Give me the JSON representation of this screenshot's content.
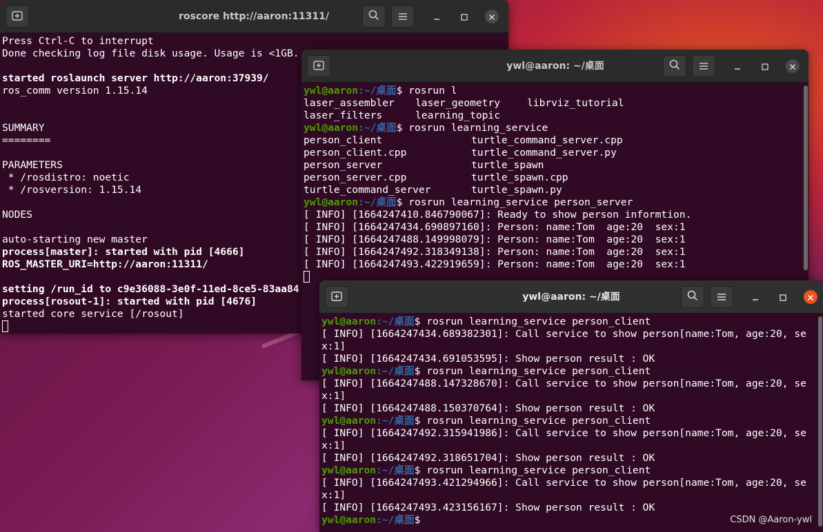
{
  "windows": {
    "roscore": {
      "title": "roscore http://aaron:11311/",
      "lines": [
        {
          "t": "Press Ctrl-C to interrupt"
        },
        {
          "t": "Done checking log file disk usage. Usage is <1GB."
        },
        {
          "t": ""
        },
        {
          "t": "started roslaunch server http://aaron:37939/",
          "bold": true
        },
        {
          "t": "ros_comm version 1.15.14"
        },
        {
          "t": ""
        },
        {
          "t": ""
        },
        {
          "t": "SUMMARY"
        },
        {
          "t": "========"
        },
        {
          "t": ""
        },
        {
          "t": "PARAMETERS"
        },
        {
          "t": " * /rosdistro: noetic"
        },
        {
          "t": " * /rosversion: 1.15.14"
        },
        {
          "t": ""
        },
        {
          "t": "NODES"
        },
        {
          "t": ""
        },
        {
          "t": "auto-starting new master"
        },
        {
          "t": "process[master]: started with pid [4666]",
          "bold": true
        },
        {
          "t": "ROS_MASTER_URI=http://aaron:11311/",
          "bold": true
        },
        {
          "t": ""
        },
        {
          "t": "setting /run_id to c9e36088-3e0f-11ed-8ce5-83aa84",
          "bold": true
        },
        {
          "t": "process[rosout-1]: started with pid [4676]",
          "bold": true
        },
        {
          "t": "started core service [/rosout]"
        }
      ]
    },
    "server": {
      "title": "ywl@aaron: ~/桌面",
      "prompt_user": "ywl@aaron",
      "prompt_path": ":~/桌面",
      "prompt_sign": "$ ",
      "lines": [
        {
          "kind": "prompt",
          "cmd": "rosrun l"
        },
        {
          "kind": "cols3",
          "cells": [
            "laser_assembler",
            "laser_geometry",
            "librviz_tutorial"
          ]
        },
        {
          "kind": "cols3",
          "cells": [
            "laser_filters",
            "learning_topic",
            ""
          ]
        },
        {
          "kind": "prompt",
          "cmd": "rosrun learning_service"
        },
        {
          "kind": "cols2",
          "cells": [
            "person_client",
            "turtle_command_server.cpp"
          ]
        },
        {
          "kind": "cols2",
          "cells": [
            "person_client.cpp",
            "turtle_command_server.py"
          ]
        },
        {
          "kind": "cols2",
          "cells": [
            "person_server",
            "turtle_spawn"
          ]
        },
        {
          "kind": "cols2",
          "cells": [
            "person_server.cpp",
            "turtle_spawn.cpp"
          ]
        },
        {
          "kind": "cols2",
          "cells": [
            "turtle_command_server",
            "turtle_spawn.py"
          ]
        },
        {
          "kind": "prompt",
          "cmd": "rosrun learning_service person_server"
        },
        {
          "kind": "text",
          "t": "[ INFO] [1664247410.846790067]: Ready to show person informtion."
        },
        {
          "kind": "text",
          "t": "[ INFO] [1664247434.690897160]: Person: name:Tom  age:20  sex:1"
        },
        {
          "kind": "text",
          "t": "[ INFO] [1664247488.149998079]: Person: name:Tom  age:20  sex:1"
        },
        {
          "kind": "text",
          "t": "[ INFO] [1664247492.318349138]: Person: name:Tom  age:20  sex:1"
        },
        {
          "kind": "text",
          "t": "[ INFO] [1664247493.422919659]: Person: name:Tom  age:20  sex:1"
        }
      ]
    },
    "client": {
      "title": "ywl@aaron: ~/桌面",
      "prompt_user": "ywl@aaron",
      "prompt_path": ":~/桌面",
      "prompt_sign": "$ ",
      "lines": [
        {
          "kind": "prompt",
          "cmd": "rosrun learning_service person_client"
        },
        {
          "kind": "text",
          "t": "[ INFO] [1664247434.689382301]: Call service to show person[name:Tom, age:20, se"
        },
        {
          "kind": "text",
          "t": "x:1]"
        },
        {
          "kind": "text",
          "t": "[ INFO] [1664247434.691053595]: Show person result : OK"
        },
        {
          "kind": "prompt",
          "cmd": "rosrun learning_service person_client"
        },
        {
          "kind": "text",
          "t": "[ INFO] [1664247488.147328670]: Call service to show person[name:Tom, age:20, se"
        },
        {
          "kind": "text",
          "t": "x:1]"
        },
        {
          "kind": "text",
          "t": "[ INFO] [1664247488.150370764]: Show person result : OK"
        },
        {
          "kind": "prompt",
          "cmd": "rosrun learning_service person_client"
        },
        {
          "kind": "text",
          "t": "[ INFO] [1664247492.315941986]: Call service to show person[name:Tom, age:20, se"
        },
        {
          "kind": "text",
          "t": "x:1]"
        },
        {
          "kind": "text",
          "t": "[ INFO] [1664247492.318651704]: Show person result : OK"
        },
        {
          "kind": "prompt",
          "cmd": "rosrun learning_service person_client"
        },
        {
          "kind": "text",
          "t": "[ INFO] [1664247493.421294966]: Call service to show person[name:Tom, age:20, se"
        },
        {
          "kind": "text",
          "t": "x:1]"
        },
        {
          "kind": "text",
          "t": "[ INFO] [1664247493.423156167]: Show person result : OK"
        },
        {
          "kind": "prompt",
          "cmd": ""
        }
      ]
    }
  },
  "watermark": "CSDN @Aaron-ywl",
  "colors": {
    "terminal_bg": "#300a24",
    "prompt_user": "#4e9a06",
    "prompt_path": "#3465a4",
    "close_active": "#e95420"
  }
}
